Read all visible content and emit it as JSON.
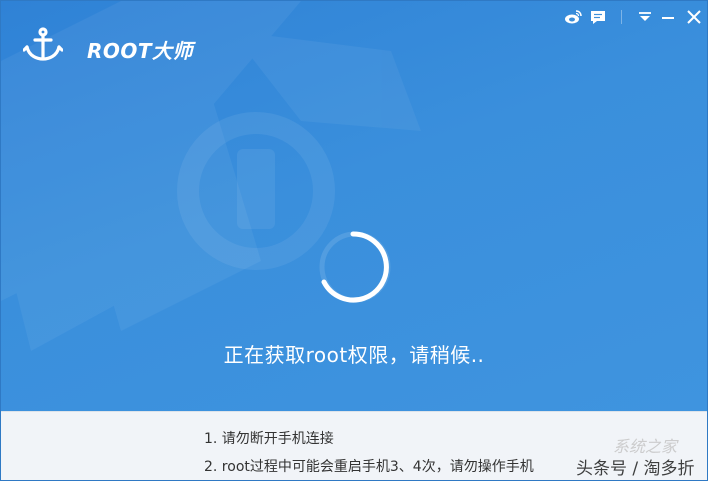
{
  "app": {
    "title": "ROOT大师",
    "logo_icon": "anchor-icon"
  },
  "titlebar": {
    "icons": [
      "weibo-icon",
      "feedback-icon",
      "menu-icon",
      "minimize-icon",
      "close-icon"
    ]
  },
  "main": {
    "status_text": "正在获取root权限，请稍候..",
    "background_watermark": "lock-icon"
  },
  "footer": {
    "tips": [
      "1. 请勿断开手机连接",
      "2. root过程中可能会重启手机3、4次，请勿操作手机"
    ]
  },
  "watermark": {
    "site": "系统之家",
    "source": "头条号 / 淘多折"
  },
  "colors": {
    "primary": "#3d8fd9",
    "footer_bg": "#f1f4f8",
    "text_light": "#ffffff",
    "text_dark": "#333333"
  }
}
